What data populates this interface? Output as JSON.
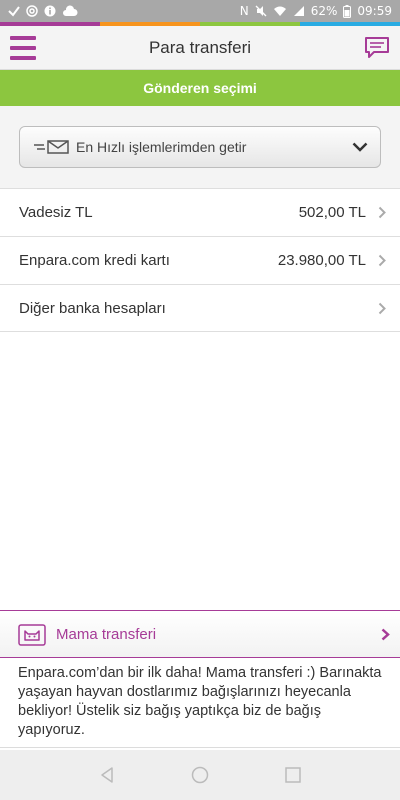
{
  "status_bar": {
    "battery": "62%",
    "time": "09:59",
    "nfc_label": "N"
  },
  "colors": {
    "accent": "#a63b97",
    "banner": "#8cc63f",
    "strip": [
      "#a63b97",
      "#f7941d",
      "#8cc63f",
      "#29abe2"
    ]
  },
  "header": {
    "title": "Para transferi",
    "menu_icon": "hamburger-icon",
    "chat_icon": "chat-icon"
  },
  "banner": {
    "text": "Gönderen seçimi"
  },
  "dropdown": {
    "selected": "En Hızlı işlemlerimden getir",
    "icon": "envelope-icon"
  },
  "accounts": [
    {
      "name": "Vadesiz TL",
      "balance": "502,00 TL"
    },
    {
      "name": "Enpara.com kredi kartı",
      "balance": "23.980,00 TL"
    },
    {
      "name": "Diğer banka hesapları",
      "balance": ""
    }
  ],
  "promo": {
    "title": "Mama transferi",
    "body": "Enpara.com’dan bir ilk daha! Mama transferi :) Barınakta yaşayan hayvan dostlarımız bağışlarınızı heyecanla bekliyor! Üstelik siz bağış yaptıkça biz de bağış yapıyoruz."
  }
}
